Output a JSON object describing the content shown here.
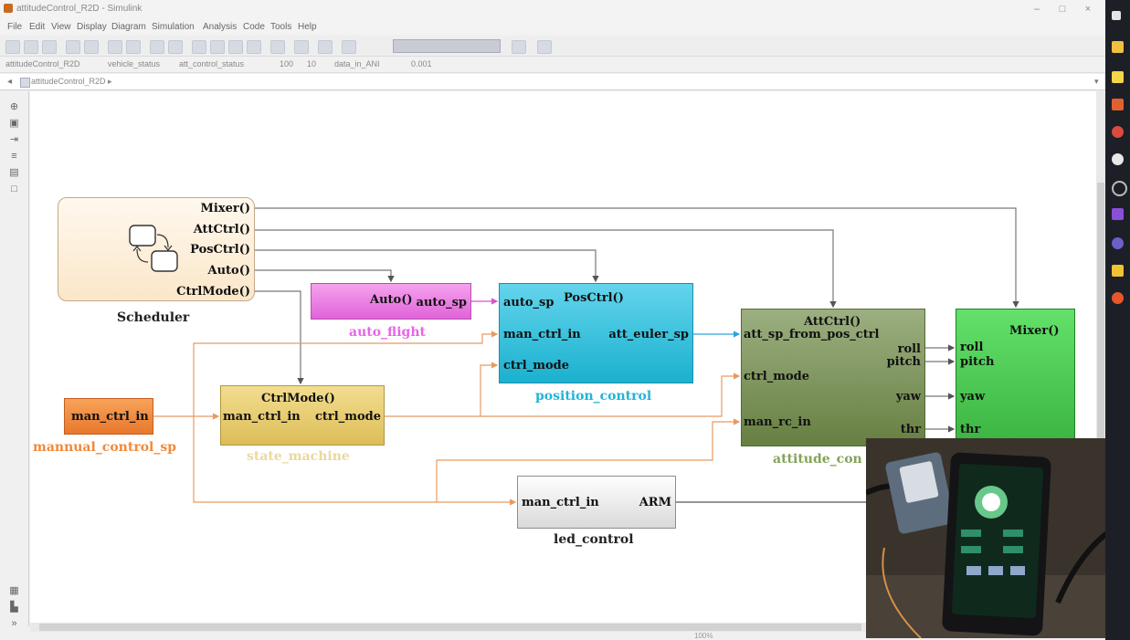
{
  "window": {
    "title": "attitudeControl_R2D - Simulink",
    "controls": [
      "–",
      "□",
      "×"
    ]
  },
  "menu": [
    "File",
    "Edit",
    "View",
    "Display",
    "Diagram",
    "Simulation",
    "Analysis",
    "Code",
    "Tools",
    "Help"
  ],
  "toolbar": {
    "sim_time": "",
    "selectors": [
      "attitudeControl_R2D",
      "vehicle_status",
      "att_control_status",
      "100",
      "10",
      "data_in_ANI",
      "0.001"
    ]
  },
  "address": {
    "breadcrumb": "attitudeControl_R2D ▸"
  },
  "diagram": {
    "scheduler": {
      "name": "Scheduler",
      "ports": [
        "Mixer()",
        "AttCtrl()",
        "PosCtrl()",
        "Auto()",
        "CtrlMode()"
      ]
    },
    "auto_flight": {
      "name": "auto_flight",
      "trigger": "Auto()",
      "output": "auto_sp"
    },
    "position_control": {
      "name": "position_control",
      "trigger": "PosCtrl()",
      "inputs": [
        "auto_sp",
        "man_ctrl_in",
        "ctrl_mode"
      ],
      "output": "att_euler_sp"
    },
    "attitude_control": {
      "name": "attitude_con",
      "trigger": "AttCtrl()",
      "inputs": [
        "att_sp_from_pos_ctrl",
        "ctrl_mode",
        "man_rc_in"
      ],
      "outputs": [
        "roll",
        "pitch",
        "yaw",
        "thr"
      ]
    },
    "mixer": {
      "trigger": "Mixer()",
      "inputs": [
        "roll",
        "pitch",
        "yaw",
        "thr"
      ]
    },
    "state_machine": {
      "name": "state_machine",
      "trigger": "CtrlMode()",
      "input": "man_ctrl_in",
      "output": "ctrl_mode"
    },
    "manual_input": {
      "name": "mannual_control_sp",
      "label": "man_ctrl_in"
    },
    "led_control": {
      "name": "led_control",
      "input": "man_ctrl_in",
      "output": "ARM"
    }
  },
  "status": {
    "zoom": "100%"
  },
  "colors": {
    "auto_flight": "#e97ee4",
    "position_control": "#2cbcd9",
    "position_label": "#23b3d6",
    "attitude_control": "#7d944f",
    "mixer": "#4ccf52",
    "state_machine": "#e6c86b",
    "state_label": "#e9d8a0",
    "manual": "#f0893a",
    "manual_label": "#f0893a",
    "auto_label": "#e765e6",
    "attitude_label": "#83a35a",
    "scheduler": "#fcebd2",
    "signal_orange": "#f2a46a",
    "signal_gray": "#555555",
    "signal_blue": "#2aa4d8"
  },
  "taskbar_icons": [
    "windows-icon",
    "file-explorer-icon",
    "sticky-notes-icon",
    "pin-icon",
    "chrome-icon",
    "settings-icon",
    "cortana-icon",
    "visual-studio-icon",
    "app-icon",
    "folder-icon",
    "firefox-icon"
  ]
}
